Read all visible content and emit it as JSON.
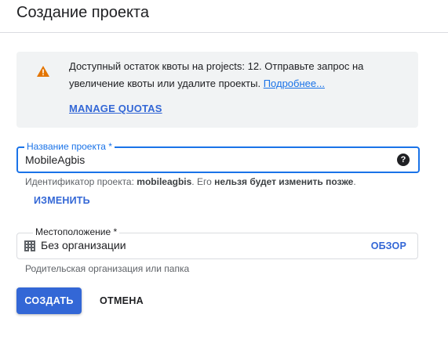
{
  "header": {
    "title": "Создание проекта"
  },
  "quota_notice": {
    "icon": "warning-icon",
    "icon_color": "#e37400",
    "message": "Доступный остаток квоты на projects: 12. Отправьте запрос на увеличение квоты или удалите проекты.",
    "more_link": "Подробнее...",
    "manage_label": "MANAGE QUOTAS"
  },
  "project_name": {
    "label": "Название проекта *",
    "value": "MobileAgbis",
    "help_icon": "help-icon",
    "id_hint_prefix": "Идентификатор проекта: ",
    "id_value": "mobileagbis",
    "id_hint_middle": ". Его ",
    "id_hint_bold": "нельзя будет изменить позже",
    "id_hint_suffix": ".",
    "change_label": "ИЗМЕНИТЬ"
  },
  "location": {
    "label": "Местоположение *",
    "icon": "organization-icon",
    "value": "Без организации",
    "browse_label": "ОБЗОР",
    "hint": "Родительская организация или папка"
  },
  "actions": {
    "create_label": "СОЗДАТЬ",
    "cancel_label": "ОТМЕНА"
  },
  "colors": {
    "accent": "#1a73e8",
    "button": "#3367d6",
    "notice_bg": "#f1f3f4"
  }
}
